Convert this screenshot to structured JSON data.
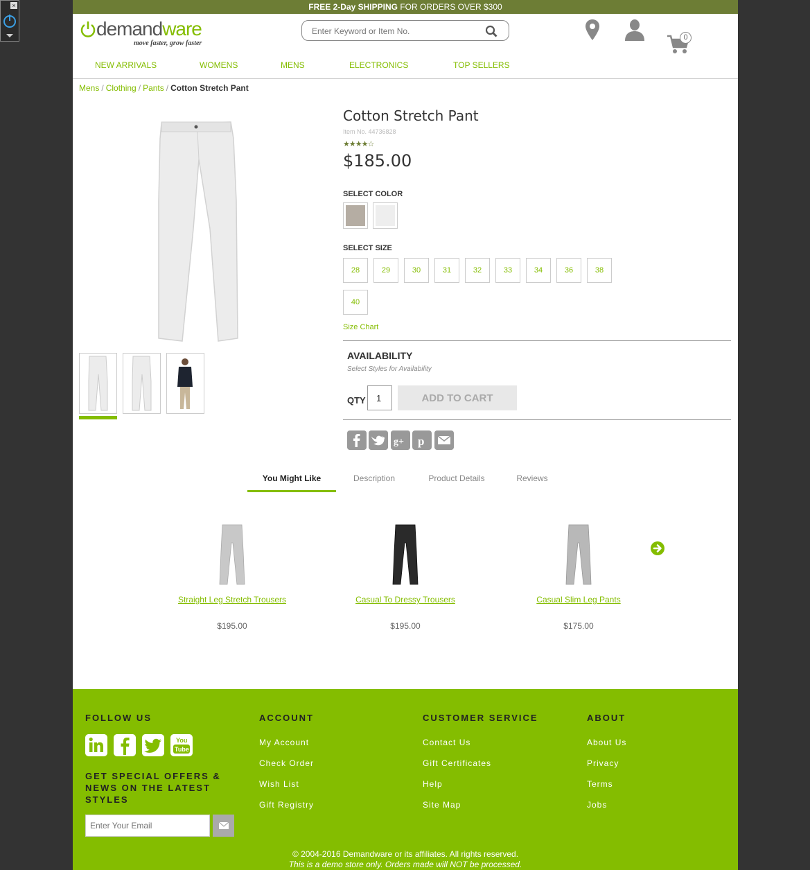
{
  "promo": {
    "bold": "FREE 2-Day SHIPPING",
    "rest": " FOR ORDERS OVER $300"
  },
  "logo": {
    "pre": "demand",
    "accent": "ware",
    "tagline": "move faster, grow faster"
  },
  "search": {
    "placeholder": "Enter Keyword or Item No."
  },
  "cart": {
    "count": "0"
  },
  "nav": [
    "NEW ARRIVALS",
    "WOMENS",
    "MENS",
    "ELECTRONICS",
    "TOP SELLERS"
  ],
  "breadcrumb": {
    "items": [
      "Mens",
      "Clothing",
      "Pants"
    ],
    "current": "Cotton Stretch Pant"
  },
  "product": {
    "title": "Cotton Stretch Pant",
    "item_no": "Item No. 44736828",
    "rating_stars": 3.5,
    "rating_glyphs": "★★★★☆",
    "price": "$185.00",
    "color_label": "SELECT COLOR",
    "colors": [
      "#b5ada3",
      "#eeeeee"
    ],
    "size_label": "SELECT SIZE",
    "sizes": [
      "28",
      "29",
      "30",
      "31",
      "32",
      "33",
      "34",
      "36",
      "38",
      "40"
    ],
    "size_chart": "Size Chart",
    "availability_title": "AVAILABILITY",
    "availability_sub": "Select Styles for Availability",
    "qty_label": "QTY",
    "qty_value": "1",
    "add_to_cart": "ADD TO CART"
  },
  "tabs": [
    "You Might Like",
    "Description",
    "Product Details",
    "Reviews"
  ],
  "recommendations": [
    {
      "name": "Straight Leg Stretch Trousers",
      "price": "$195.00",
      "color": "#c8c8c8"
    },
    {
      "name": "Casual To Dressy Trousers",
      "price": "$195.00",
      "color": "#2a2a2a"
    },
    {
      "name": "Casual Slim Leg Pants",
      "price": "$175.00",
      "color": "#b8b8b8"
    }
  ],
  "footer": {
    "follow_us": "FOLLOW US",
    "offers": "GET SPECIAL OFFERS & NEWS ON THE LATEST STYLES",
    "email_placeholder": "Enter Your Email",
    "account": {
      "heading": "ACCOUNT",
      "links": [
        "My Account",
        "Check Order",
        "Wish List",
        "Gift Registry"
      ]
    },
    "customer_service": {
      "heading": "CUSTOMER SERVICE",
      "links": [
        "Contact Us",
        "Gift Certificates",
        "Help",
        "Site Map"
      ]
    },
    "about": {
      "heading": "ABOUT",
      "links": [
        "About Us",
        "Privacy",
        "Terms",
        "Jobs"
      ]
    },
    "copyright": "© 2004-2016 Demandware or its affiliates. All rights reserved.",
    "disclaimer": "This is a demo store only. Orders made will NOT be processed."
  },
  "colors": {
    "accent": "#84bd00",
    "promo_bar": "#6d7d35",
    "background": "#333333"
  }
}
